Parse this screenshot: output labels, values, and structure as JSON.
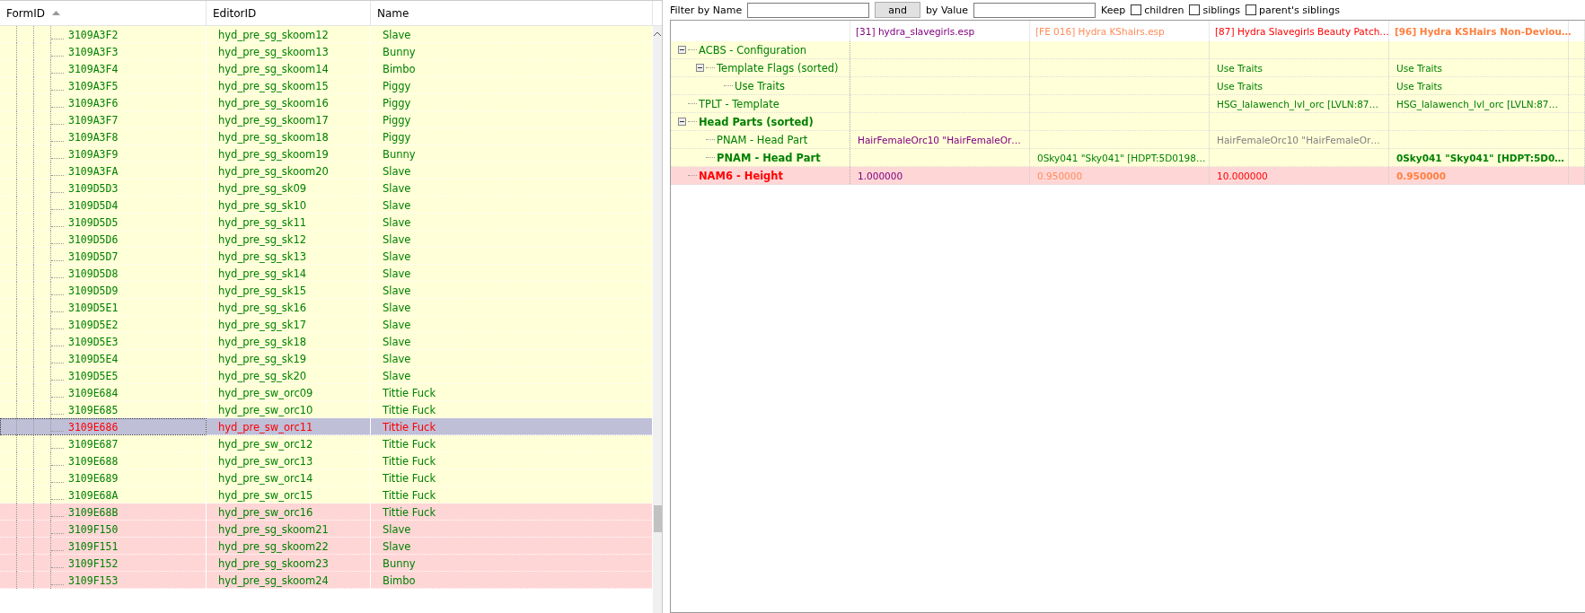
{
  "record_list": {
    "columns": [
      {
        "label": "FormID",
        "sorted": true
      },
      {
        "label": "EditorID",
        "sorted": false
      },
      {
        "label": "Name",
        "sorted": false
      }
    ],
    "rows": [
      {
        "form_id": "3109A3F2",
        "editor_id": "hyd_pre_sg_skoom12",
        "name": "Slave",
        "conflict": false,
        "selected": false
      },
      {
        "form_id": "3109A3F3",
        "editor_id": "hyd_pre_sg_skoom13",
        "name": "Bunny",
        "conflict": false,
        "selected": false
      },
      {
        "form_id": "3109A3F4",
        "editor_id": "hyd_pre_sg_skoom14",
        "name": "Bimbo",
        "conflict": false,
        "selected": false
      },
      {
        "form_id": "3109A3F5",
        "editor_id": "hyd_pre_sg_skoom15",
        "name": "Piggy",
        "conflict": false,
        "selected": false
      },
      {
        "form_id": "3109A3F6",
        "editor_id": "hyd_pre_sg_skoom16",
        "name": "Piggy",
        "conflict": false,
        "selected": false
      },
      {
        "form_id": "3109A3F7",
        "editor_id": "hyd_pre_sg_skoom17",
        "name": "Piggy",
        "conflict": false,
        "selected": false
      },
      {
        "form_id": "3109A3F8",
        "editor_id": "hyd_pre_sg_skoom18",
        "name": "Piggy",
        "conflict": false,
        "selected": false
      },
      {
        "form_id": "3109A3F9",
        "editor_id": "hyd_pre_sg_skoom19",
        "name": "Bunny",
        "conflict": false,
        "selected": false
      },
      {
        "form_id": "3109A3FA",
        "editor_id": "hyd_pre_sg_skoom20",
        "name": "Slave",
        "conflict": false,
        "selected": false
      },
      {
        "form_id": "3109D5D3",
        "editor_id": "hyd_pre_sg_sk09",
        "name": "Slave",
        "conflict": false,
        "selected": false
      },
      {
        "form_id": "3109D5D4",
        "editor_id": "hyd_pre_sg_sk10",
        "name": "Slave",
        "conflict": false,
        "selected": false
      },
      {
        "form_id": "3109D5D5",
        "editor_id": "hyd_pre_sg_sk11",
        "name": "Slave",
        "conflict": false,
        "selected": false
      },
      {
        "form_id": "3109D5D6",
        "editor_id": "hyd_pre_sg_sk12",
        "name": "Slave",
        "conflict": false,
        "selected": false
      },
      {
        "form_id": "3109D5D7",
        "editor_id": "hyd_pre_sg_sk13",
        "name": "Slave",
        "conflict": false,
        "selected": false
      },
      {
        "form_id": "3109D5D8",
        "editor_id": "hyd_pre_sg_sk14",
        "name": "Slave",
        "conflict": false,
        "selected": false
      },
      {
        "form_id": "3109D5D9",
        "editor_id": "hyd_pre_sg_sk15",
        "name": "Slave",
        "conflict": false,
        "selected": false
      },
      {
        "form_id": "3109D5E1",
        "editor_id": "hyd_pre_sg_sk16",
        "name": "Slave",
        "conflict": false,
        "selected": false
      },
      {
        "form_id": "3109D5E2",
        "editor_id": "hyd_pre_sg_sk17",
        "name": "Slave",
        "conflict": false,
        "selected": false
      },
      {
        "form_id": "3109D5E3",
        "editor_id": "hyd_pre_sg_sk18",
        "name": "Slave",
        "conflict": false,
        "selected": false
      },
      {
        "form_id": "3109D5E4",
        "editor_id": "hyd_pre_sg_sk19",
        "name": "Slave",
        "conflict": false,
        "selected": false
      },
      {
        "form_id": "3109D5E5",
        "editor_id": "hyd_pre_sg_sk20",
        "name": "Slave",
        "conflict": false,
        "selected": false
      },
      {
        "form_id": "3109E684",
        "editor_id": "hyd_pre_sw_orc09",
        "name": "Tittie Fuck",
        "conflict": false,
        "selected": false
      },
      {
        "form_id": "3109E685",
        "editor_id": "hyd_pre_sw_orc10",
        "name": "Tittie Fuck",
        "conflict": false,
        "selected": false
      },
      {
        "form_id": "3109E686",
        "editor_id": "hyd_pre_sw_orc11",
        "name": "Tittie Fuck",
        "conflict": false,
        "selected": true
      },
      {
        "form_id": "3109E687",
        "editor_id": "hyd_pre_sw_orc12",
        "name": "Tittie Fuck",
        "conflict": false,
        "selected": false
      },
      {
        "form_id": "3109E688",
        "editor_id": "hyd_pre_sw_orc13",
        "name": "Tittie Fuck",
        "conflict": false,
        "selected": false
      },
      {
        "form_id": "3109E689",
        "editor_id": "hyd_pre_sw_orc14",
        "name": "Tittie Fuck",
        "conflict": false,
        "selected": false
      },
      {
        "form_id": "3109E68A",
        "editor_id": "hyd_pre_sw_orc15",
        "name": "Tittie Fuck",
        "conflict": false,
        "selected": false
      },
      {
        "form_id": "3109E68B",
        "editor_id": "hyd_pre_sw_orc16",
        "name": "Tittie Fuck",
        "conflict": true,
        "selected": false
      },
      {
        "form_id": "3109F150",
        "editor_id": "hyd_pre_sg_skoom21",
        "name": "Slave",
        "conflict": true,
        "selected": false
      },
      {
        "form_id": "3109F151",
        "editor_id": "hyd_pre_sg_skoom22",
        "name": "Slave",
        "conflict": true,
        "selected": false
      },
      {
        "form_id": "3109F152",
        "editor_id": "hyd_pre_sg_skoom23",
        "name": "Bunny",
        "conflict": true,
        "selected": false
      },
      {
        "form_id": "3109F153",
        "editor_id": "hyd_pre_sg_skoom24",
        "name": "Bimbo",
        "conflict": true,
        "selected": false
      }
    ]
  },
  "filter_bar": {
    "name_label": "Filter by Name",
    "and_button": "and",
    "value_label": "by Value",
    "keep_label": "Keep",
    "options": [
      {
        "label": "children",
        "checked": false
      },
      {
        "label": "siblings",
        "checked": false
      },
      {
        "label": "parent's siblings",
        "checked": false
      }
    ]
  },
  "record_view": {
    "files": [
      {
        "label": "[31] hydra_slavegirls.esp",
        "color": "#800080",
        "bold": false
      },
      {
        "label": "[FE 016] Hydra KShairs.esp",
        "color": "#ff8c5a",
        "bold": false
      },
      {
        "label": "[87] Hydra Slavegirls Beauty Patch…",
        "color": "#ff0000",
        "bold": false
      },
      {
        "label": "[96] Hydra KSHairs Non-Deviou…",
        "color": "#ff8040",
        "bold": true
      }
    ],
    "rows": [
      {
        "label": "ACBS - Configuration",
        "bold": false,
        "conflict": false,
        "expanded": true,
        "cells": [
          null,
          null,
          null,
          null
        ],
        "children": [
          {
            "label": "Template Flags (sorted)",
            "bold": false,
            "conflict": false,
            "expanded": true,
            "cells": [
              null,
              null,
              {
                "text": "Use Traits",
                "color": "#008000",
                "bold": false
              },
              {
                "text": "Use Traits",
                "color": "#008000",
                "bold": false
              }
            ],
            "children": [
              {
                "label": "Use Traits",
                "bold": false,
                "conflict": false,
                "cells": [
                  null,
                  null,
                  {
                    "text": "Use Traits",
                    "color": "#008000",
                    "bold": false
                  },
                  {
                    "text": "Use Traits",
                    "color": "#008000",
                    "bold": false
                  }
                ]
              }
            ]
          }
        ]
      },
      {
        "label": "TPLT - Template",
        "bold": false,
        "conflict": false,
        "cells": [
          null,
          null,
          {
            "text": "HSG_lalawench_lvl_orc [LVLN:87…",
            "color": "#008000",
            "bold": false
          },
          {
            "text": "HSG_lalawench_lvl_orc [LVLN:87…",
            "color": "#008000",
            "bold": false
          }
        ]
      },
      {
        "label": "Head Parts (sorted)",
        "bold": true,
        "conflict": false,
        "expanded": true,
        "cells": [
          null,
          null,
          null,
          null
        ],
        "children": [
          {
            "label": "PNAM - Head Part",
            "bold": false,
            "conflict": false,
            "cells": [
              {
                "text": "HairFemaleOrc10 \"HairFemaleOr…",
                "color": "#800080",
                "bold": false
              },
              null,
              {
                "text": "HairFemaleOrc10 \"HairFemaleOr…",
                "color": "#808080",
                "bold": false
              },
              null
            ]
          },
          {
            "label": "PNAM - Head Part",
            "bold": true,
            "conflict": false,
            "cells": [
              null,
              {
                "text": "0Sky041 \"Sky041\" [HDPT:5D0198…",
                "color": "#008000",
                "bold": false
              },
              null,
              {
                "text": "0Sky041 \"Sky041\" [HDPT:5D0…",
                "color": "#008000",
                "bold": true
              }
            ]
          }
        ]
      },
      {
        "label": "NAM6 - Height",
        "bold": true,
        "conflict": true,
        "cells": [
          {
            "text": "1.000000",
            "color": "#800080",
            "bold": false
          },
          {
            "text": "0.950000",
            "color": "#ff8c5a",
            "bold": false
          },
          {
            "text": "10.000000",
            "color": "#ff0000",
            "bold": false
          },
          {
            "text": "0.950000",
            "color": "#ff8040",
            "bold": true
          }
        ]
      }
    ]
  }
}
